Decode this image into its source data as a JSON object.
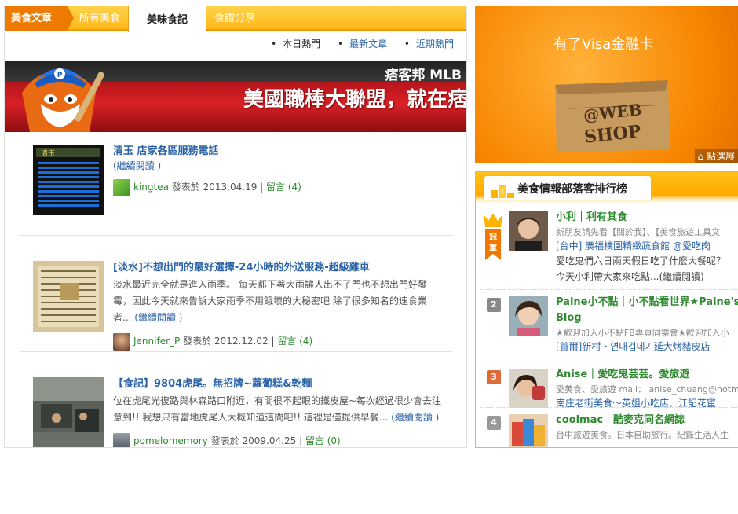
{
  "tabs": {
    "brand": "美食文章",
    "all": "所有美食",
    "active": "美味食記",
    "share": "食譜分享"
  },
  "subnav": {
    "today": "本日熱門",
    "latest": "最新文章",
    "recent": "近期熱門"
  },
  "banner": {
    "logo": "痞客邦 MLB",
    "title": "美國職棒大聯盟，就在痞"
  },
  "posts": [
    {
      "title": "清玉 店家各區服務電話",
      "excerpt": "",
      "readmore": "(繼續閱讀 )",
      "user": "kingtea",
      "posted_label": "發表於",
      "date": "2013.04.19",
      "comments": "留言 (4)"
    },
    {
      "title": "[淡水]不想出門的最好選擇-24小時的外送服務-超級雞車",
      "excerpt": "淡水最近完全就是進入雨季。 每天都下著大雨讓人出不了門也不想出門好發霉，因此今天就來告訴大家雨季不用餓壞的大秘密吧 除了很多知名的速食業者...",
      "readmore": "(繼續閱讀 )",
      "user": "Jennifer_P",
      "posted_label": "發表於",
      "date": "2012.12.02",
      "comments": "留言 (4)"
    },
    {
      "title": "【食記】9804虎尾。無招牌~蘿蔔糕&乾麵",
      "excerpt": "位在虎尾光復路與林森路口附近，有間很不起眼的鐵皮屋~每次經過很少會去注意到!! 我想只有當地虎尾人大概知道這間吧!! 這裡是僅提供早餐...",
      "readmore": "(繼續閱讀 )",
      "user": "pomelomemory",
      "posted_label": "發表於",
      "date": "2009.04.25",
      "comments": "留言 (0)"
    }
  ],
  "ad": {
    "text": "有了Visa金融卡",
    "box_text_1": "@WEB",
    "box_text_2": "SHOP",
    "corner": "點選展"
  },
  "ranking": {
    "title": "美食情報部落客排行榜",
    "crown_text": "冠軍",
    "items": [
      {
        "rank": "1",
        "name": "小利｜利有其食",
        "desc": "新朋友請先看【關於我】、【美食旅遊工具文",
        "post": "[台中] 廣福樸園精緻蔬食館 @愛吃肉",
        "snippet_1": "愛吃鬼們六日兩天假日吃了什麼大餐呢？",
        "snippet_2": "今天小利帶大家來吃點...(繼續閱讀)"
      },
      {
        "rank": "2",
        "name": "Paine小不點｜小不點看世界★Paine's Blog",
        "desc": "★歡迎加入小不點FB專頁同樂會★歡迎加入小",
        "post": "[首爾]新村・연대겁데기延大烤豬皮店"
      },
      {
        "rank": "3",
        "name": "Anise｜愛吃鬼芸芸。愛旅遊",
        "desc": "愛美食、愛旅遊 mail： anise_chuang@hotmail.",
        "post": "南庄老街美食～英姐小吃店、江記花蜜"
      },
      {
        "rank": "4",
        "name": "coolmac｜酷麥克同名網誌",
        "desc": "台中旅遊美食。日本自助旅行。紀錄生活人生"
      }
    ]
  },
  "colors": {
    "tab_orange": "#f59a00",
    "link_blue": "#2a62a8",
    "user_green": "#2f8a2f",
    "rank1": "#f0a000",
    "rank2": "#888888",
    "rank3": "#e06a3a",
    "rank4": "#999999"
  }
}
